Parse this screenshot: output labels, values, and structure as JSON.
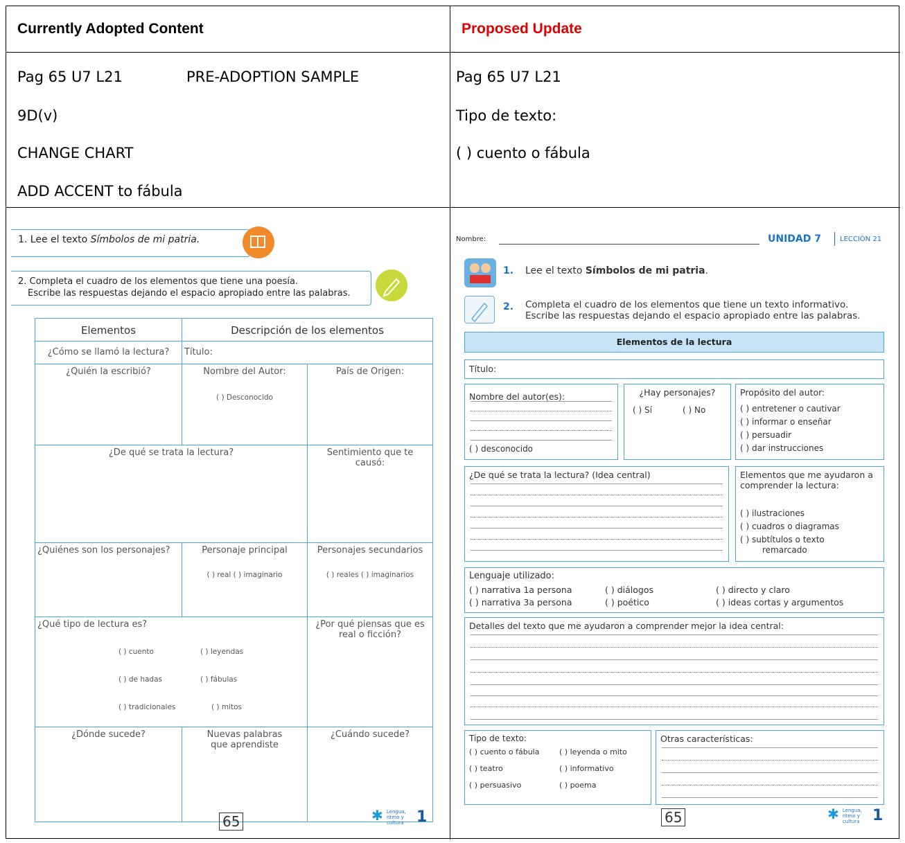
{
  "header": {
    "left": "Currently Adopted Content",
    "right": "Proposed Update"
  },
  "colors": {
    "accent_red": "#e00000",
    "line_blue": "#4aa8d8",
    "unit_blue": "#1a73c8",
    "orange": "#f08a2a",
    "green": "#c8d83a"
  },
  "current_notes": {
    "line1a": "Pag 65 U7 L21",
    "line1b": "PRE-ADOPTION SAMPLE",
    "line2": "9D(v)",
    "line3": "CHANGE CHART",
    "line4": "ADD ACCENT to fábula"
  },
  "proposed_notes": {
    "line1": "Pag 65 U7 L21",
    "line2": "Tipo de texto:",
    "line3": "( ) cuento o fábula"
  },
  "left_ws": {
    "instr1_prefix": "1. Lee el texto ",
    "instr1_title": "Símbolos de mi patria.",
    "instr2_line1": "2. Completa el cuadro de los elementos que tiene una poesía.",
    "instr2_line2": "Escribe las respuestas dejando el espacio apropiado entre las palabras.",
    "col1": "Elementos",
    "col2": "Descripción de los elementos",
    "q1": "¿Cómo se llamó la lectura?",
    "titulo": "Título:",
    "q2": "¿Quién la escribió?",
    "autor": "Nombre del Autor:",
    "desconocido": "(   ) Desconocido",
    "pais": "País de Origen:",
    "q3": "¿De qué se trata la lectura?",
    "sentimiento": "Sentimiento que te causó:",
    "q4": "¿Quiénes son los personajes?",
    "principal": "Personaje principal",
    "real": "(   ) real (   ) imaginario",
    "secundarios": "Personajes secundarios",
    "reales": "(   ) reales (   ) imaginarios",
    "q5": "¿Qué tipo de lectura es?",
    "porque": "¿Por qué piensas que es real o ficción?",
    "t1": "(   ) cuento",
    "t2": "(   ) leyendas",
    "t3": "(   ) de hadas",
    "t4": "(   ) fábulas",
    "t5": "(   ) tradicionales",
    "t6": "(   ) mitos",
    "donde": "¿Dónde sucede?",
    "nuevas": "Nuevas palabras que aprendiste",
    "cuando": "¿Cuándo sucede?",
    "page": "65",
    "logo_text": "Lengua, ritmo y cultura",
    "grade": "1"
  },
  "right_ws": {
    "nombre": "Nombre:",
    "unidad": "UNIDAD 7",
    "leccion": "LECCIÓN 21",
    "i1_num": "1.",
    "i1_text": "Lee el texto ",
    "i1_title": "Símbolos de mi patria",
    "i2_num": "2.",
    "i2_line1": "Completa el cuadro de los elementos que tiene un texto informativo.",
    "i2_line2": "Escribe las respuestas dejando el espacio apropiado entre las palabras.",
    "banner": "Elementos de la lectura",
    "titulo": "Título:",
    "autor": "Nombre del autor(es):",
    "desconocido": "(    ) desconocido",
    "personajes": "¿Hay personajes?",
    "si": "(    ) Sí",
    "no": "(    ) No",
    "proposito": "Propósito del autor:",
    "p1": "(    ) entretener o cautivar",
    "p2": "(    ) informar o enseñar",
    "p3": "(    ) persuadir",
    "p4": "(    ) dar instrucciones",
    "trata": "¿De qué se trata la lectura? (Idea central)",
    "ayudaron": "Elementos que me ayudaron a comprender la lectura:",
    "a1": "(    ) ilustraciones",
    "a2": "(    ) cuadros o diagramas",
    "a3": "(    ) subtítulos o texto",
    "a3b": "remarcado",
    "lenguaje": "Lenguaje utilizado:",
    "l1": "(    ) narrativa 1a persona",
    "l2": "(    ) diálogos",
    "l3": "(    ) directo y claro",
    "l4": "(    ) narrativa 3a persona",
    "l5": "(    ) poético",
    "l6": "(    ) ideas cortas y argumentos",
    "detalles": "Detalles del texto que me ayudaron a comprender mejor la idea central:",
    "tipo": "Tipo de texto:",
    "ty1": "(    ) cuento o fábula",
    "ty2": "(    ) leyenda o mito",
    "ty3": "(    ) teatro",
    "ty4": "(    ) informativo",
    "ty5": "(    ) persuasivo",
    "ty6": "(    ) poema",
    "otras": "Otras características:",
    "page": "65",
    "logo_text": "Lengua, ritmo y cultura",
    "grade": "1"
  }
}
